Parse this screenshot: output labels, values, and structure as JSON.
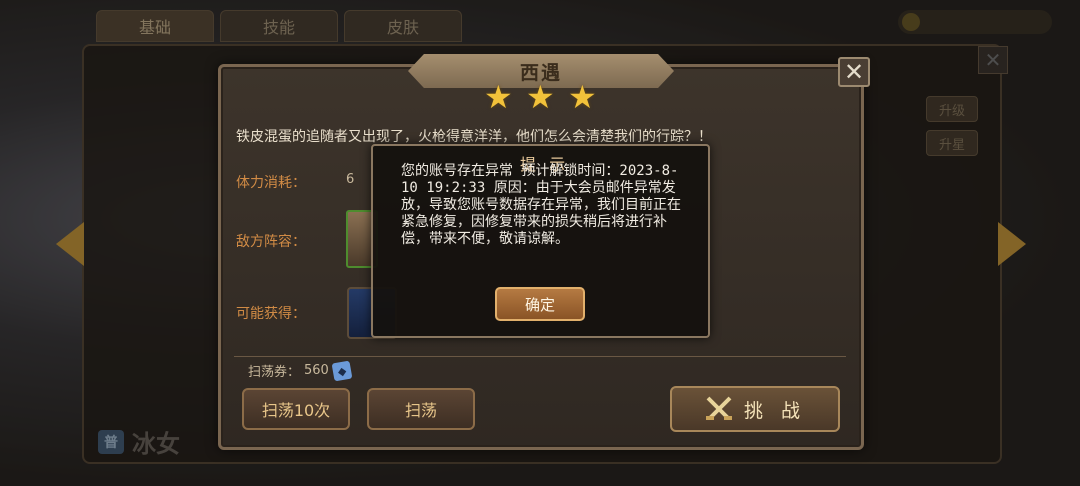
{
  "background": {
    "tabs": [
      "基础",
      "技能",
      "皮肤"
    ],
    "character_name": "冰女",
    "character_badge": "普",
    "side_buttons": [
      "升级",
      "升星"
    ]
  },
  "stage_dialog": {
    "title": "西遇",
    "stars": 3,
    "description": "铁皮混蛋的追随者又出现了，火枪得意洋洋，他们怎么会清楚我们的行踪？！",
    "stamina_label": "体力消耗：",
    "stamina_value": "6",
    "enemy_label": "敌方阵容：",
    "reward_label": "可能获得：",
    "sweep_ticket_label": "扫荡券：",
    "sweep_ticket_count": "560",
    "sweep10_button": "扫荡10次",
    "sweep_button": "扫荡",
    "challenge_button": "挑 战"
  },
  "notice": {
    "title": "提 示",
    "message": "您的账号存在异常 预计解锁时间：2023-8-10 19:2:33 原因：由于大会员邮件异常发放，导致您账号数据存在异常，我们目前正在紧急修复，因修复带来的损失稍后将进行补偿，带来不便，敬请谅解。",
    "confirm_button": "确定"
  },
  "colors": {
    "accent_orange": "#d18b45",
    "star_gold": "#f2c23a",
    "confirm_button": "#b57a42",
    "frame_brown": "#7a6650"
  },
  "icons": [
    "close-icon",
    "star-icon",
    "arrow-left-icon",
    "arrow-right-icon",
    "ticket-icon",
    "swords-icon"
  ]
}
